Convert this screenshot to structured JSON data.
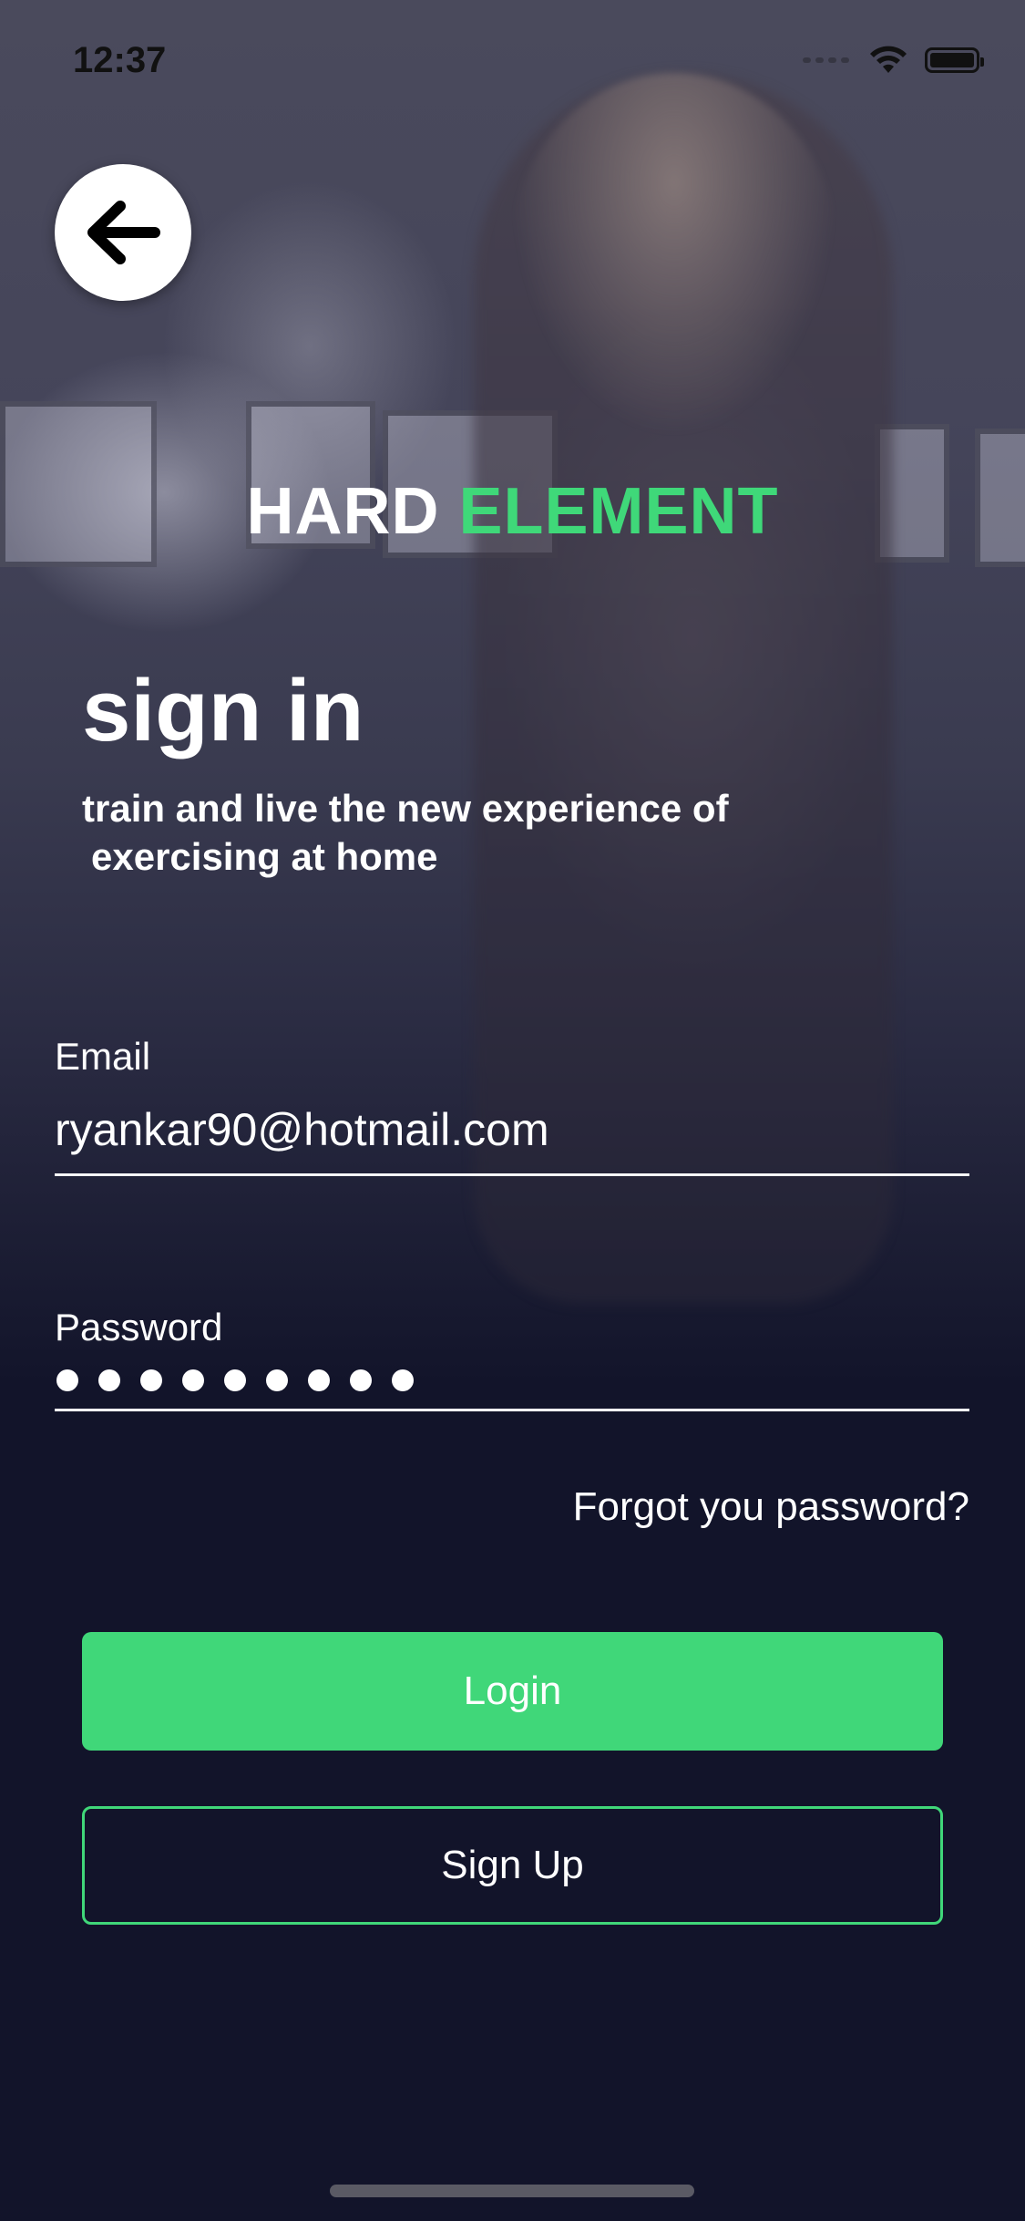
{
  "status_bar": {
    "time": "12:37",
    "icons": [
      "signal-icon",
      "wifi-icon",
      "battery-icon"
    ]
  },
  "back_button": {
    "icon": "arrow-left-icon"
  },
  "brand": {
    "part1": "HARD",
    "part2": "ELEMENT"
  },
  "heading": {
    "title": "sign in",
    "subtitle_line1": "train and live the new experience of",
    "subtitle_line2": "exercising at home"
  },
  "form": {
    "email_label": "Email",
    "email_value": "ryankar90@hotmail.com",
    "password_label": "Password",
    "password_masked_length": 9,
    "forgot_label": "Forgot you password?"
  },
  "actions": {
    "login_label": "Login",
    "signup_label": "Sign Up"
  },
  "colors": {
    "accent": "#40d779",
    "background": "#12142a",
    "text": "#ffffff"
  }
}
